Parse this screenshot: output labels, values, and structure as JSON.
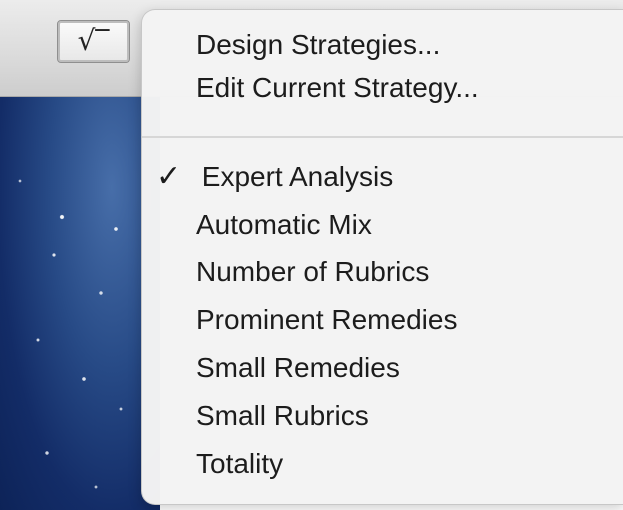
{
  "toolbar": {
    "strategy_button_symbol": "√‾",
    "strategy_button_icon": "square-root-icon"
  },
  "menu": {
    "top_items": [
      {
        "label": "Design Strategies..."
      },
      {
        "label": "Edit Current Strategy..."
      }
    ],
    "strategy_items": [
      {
        "label": "Expert Analysis",
        "checked": true,
        "check_symbol": "✓"
      },
      {
        "label": "Automatic Mix"
      },
      {
        "label": "Number of Rubrics"
      },
      {
        "label": "Prominent Remedies"
      },
      {
        "label": "Small Remedies"
      },
      {
        "label": "Small Rubrics"
      },
      {
        "label": "Totality"
      }
    ]
  },
  "colors": {
    "menu_background": "#f3f3f3",
    "text": "#1c1c1c",
    "desktop_blue": "#274a86"
  }
}
